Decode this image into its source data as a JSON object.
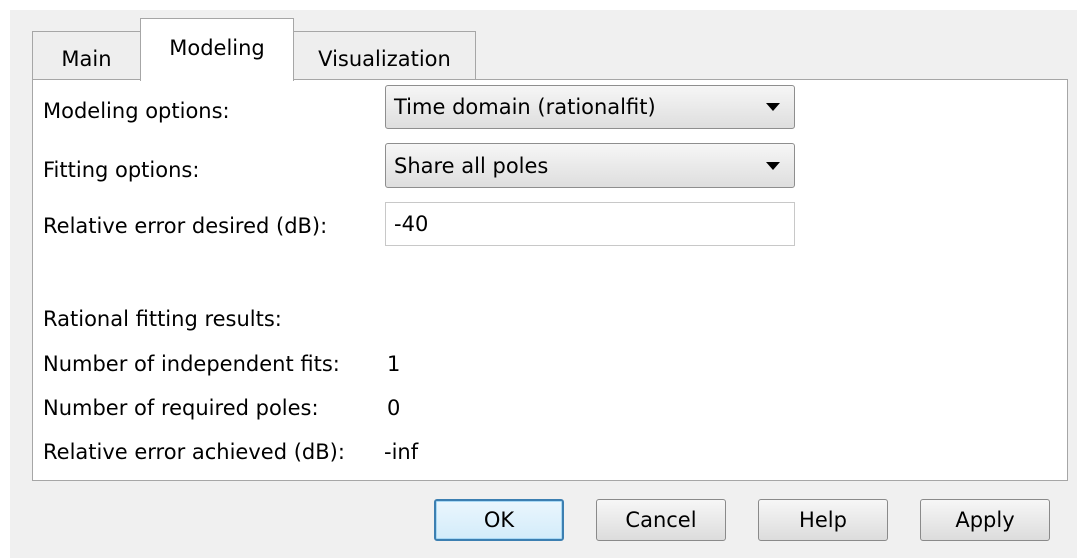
{
  "tabs": [
    {
      "label": "Main",
      "active": false
    },
    {
      "label": "Modeling",
      "active": true
    },
    {
      "label": "Visualization",
      "active": false
    }
  ],
  "modeling": {
    "modeling_options_label": "Modeling options:",
    "modeling_options_value": "Time domain (rationalfit)",
    "fitting_options_label": "Fitting options:",
    "fitting_options_value": "Share all poles",
    "relative_error_label": "Relative error desired (dB):",
    "relative_error_value": "-40"
  },
  "results": {
    "heading": "Rational fitting results:",
    "independent_fits_label": "Number of independent fits:",
    "independent_fits_value": "1",
    "required_poles_label": "Number of required poles:",
    "required_poles_value": "0",
    "error_achieved_label": "Relative error achieved (dB):",
    "error_achieved_value": "-inf"
  },
  "buttons": {
    "ok": "OK",
    "cancel": "Cancel",
    "help": "Help",
    "apply": "Apply"
  },
  "icons": {
    "dropdown": "chevron-down-icon"
  },
  "colors": {
    "default_button_border": "#3c7fb1",
    "dialog_background": "#f0f0f0",
    "panel_background": "#ffffff"
  }
}
